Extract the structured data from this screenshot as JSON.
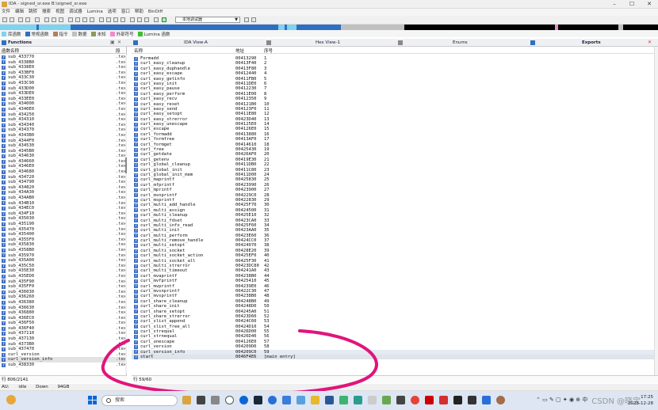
{
  "window": {
    "title": "IDA - signed_sr.exe B:\\signed_sr.exe",
    "controls": [
      "–",
      "☐",
      "✕"
    ]
  },
  "menubar": [
    "文件",
    "编辑",
    "跳转",
    "搜索",
    "视图",
    "调试器",
    "Lumina",
    "选项",
    "窗口",
    "帮助",
    "BinDiff"
  ],
  "toolbar": {
    "debugger_select": "本地调试器"
  },
  "legend": [
    {
      "label": "库函数",
      "color": "#7fd3f0"
    },
    {
      "label": "常规函数",
      "color": "#2f6fc0"
    },
    {
      "label": "指令",
      "color": "#b08060"
    },
    {
      "label": "数据",
      "color": "#c0c0c0"
    },
    {
      "label": "未知",
      "color": "#8a9a5b"
    },
    {
      "label": "外部符号",
      "color": "#f08ad0"
    },
    {
      "label": "Lumina 函数",
      "color": "#3cc030"
    }
  ],
  "tabs": {
    "functions": "Functions",
    "ida_view": "IDA View-A",
    "hex_view": "Hex View-1",
    "enums": "Enums",
    "exports": "Exports"
  },
  "functions_pane": {
    "header_name": "函数名称",
    "header_seg": "段",
    "rows": [
      {
        "name": "sub_433770",
        "seg": ".tex"
      },
      {
        "name": "sub_4338B0",
        "seg": ".tex"
      },
      {
        "name": "sub_4338E0",
        "seg": ".tex"
      },
      {
        "name": "sub_433BF0",
        "seg": ".tex"
      },
      {
        "name": "sub_433C30",
        "seg": ".tex"
      },
      {
        "name": "sub_433C90",
        "seg": ".tex"
      },
      {
        "name": "sub_433D00",
        "seg": ".tex"
      },
      {
        "name": "sub_433DE0",
        "seg": ".tex"
      },
      {
        "name": "sub_433EE0",
        "seg": ".tex"
      },
      {
        "name": "sub_434000",
        "seg": ".tex"
      },
      {
        "name": "sub_4340E0",
        "seg": ".tex"
      },
      {
        "name": "sub_434250",
        "seg": ".tex"
      },
      {
        "name": "sub_434310",
        "seg": ".tex"
      },
      {
        "name": "sub_434340",
        "seg": ".tex"
      },
      {
        "name": "sub_434370",
        "seg": ".tex"
      },
      {
        "name": "sub_4343B0",
        "seg": ".tex"
      },
      {
        "name": "sub_4344F0",
        "seg": ".tex"
      },
      {
        "name": "sub_434530",
        "seg": ".tex"
      },
      {
        "name": "sub_4345B0",
        "seg": ".tex"
      },
      {
        "name": "sub_434630",
        "seg": ".tex"
      },
      {
        "name": "sub_434660",
        "seg": ".tex"
      },
      {
        "name": "sub_4346E0",
        "seg": ".tex"
      },
      {
        "name": "sub_434680",
        "seg": ".tex"
      },
      {
        "name": "sub_434720",
        "seg": ".tex"
      },
      {
        "name": "sub_434790",
        "seg": ".tex"
      },
      {
        "name": "sub_434820",
        "seg": ".tex"
      },
      {
        "name": "sub_434A30",
        "seg": ".tex"
      },
      {
        "name": "sub_434AB0",
        "seg": ".tex"
      },
      {
        "name": "sub_434B10",
        "seg": ".tex"
      },
      {
        "name": "sub_434EC0",
        "seg": ".tex"
      },
      {
        "name": "sub_434F10",
        "seg": ".tex"
      },
      {
        "name": "sub_435030",
        "seg": ".tex"
      },
      {
        "name": "sub_435190",
        "seg": ".tex"
      },
      {
        "name": "sub_435470",
        "seg": ".tex"
      },
      {
        "name": "sub_435400",
        "seg": ".tex"
      },
      {
        "name": "sub_4355F0",
        "seg": ".tex"
      },
      {
        "name": "sub_435830",
        "seg": ".tex"
      },
      {
        "name": "sub_4358B0",
        "seg": ".tex"
      },
      {
        "name": "sub_435970",
        "seg": ".tex"
      },
      {
        "name": "sub_435A00",
        "seg": ".tex"
      },
      {
        "name": "sub_435C50",
        "seg": ".tex"
      },
      {
        "name": "sub_435E30",
        "seg": ".tex"
      },
      {
        "name": "sub_435ED0",
        "seg": ".tex"
      },
      {
        "name": "sub_435F90",
        "seg": ".tex"
      },
      {
        "name": "sub_435FF0",
        "seg": ".tex"
      },
      {
        "name": "sub_436030",
        "seg": ".tex"
      },
      {
        "name": "sub_436260",
        "seg": ".tex"
      },
      {
        "name": "sub_436380",
        "seg": ".tex"
      },
      {
        "name": "sub_436630",
        "seg": ".tex"
      },
      {
        "name": "sub_436880",
        "seg": ".tex"
      },
      {
        "name": "sub_436EC0",
        "seg": ".tex"
      },
      {
        "name": "sub_436F50",
        "seg": ".tex"
      },
      {
        "name": "sub_436F40",
        "seg": ".tex"
      },
      {
        "name": "sub_437110",
        "seg": ".tex"
      },
      {
        "name": "sub_437130",
        "seg": ".tex"
      },
      {
        "name": "sub_4373B0",
        "seg": ".tex"
      },
      {
        "name": "sub_437470",
        "seg": ".tex"
      },
      {
        "name": "curl_version",
        "seg": ".tex"
      },
      {
        "name": "curl_version_info",
        "seg": ".tex",
        "highlight": true
      },
      {
        "name": "sub_438330",
        "seg": ".tex"
      }
    ]
  },
  "exports_pane": {
    "header_name": "名称",
    "header_addr": "地址",
    "header_ord": "序号",
    "rows": [
      {
        "name": "Formadd",
        "addr": "00413290",
        "ord": "1"
      },
      {
        "name": "curl_easy_cleanup",
        "addr": "00413F40",
        "ord": "2"
      },
      {
        "name": "curl_easy_duphandle",
        "addr": "00413F80",
        "ord": "3"
      },
      {
        "name": "curl_easy_escape",
        "addr": "00412440",
        "ord": "4"
      },
      {
        "name": "curl_easy_getinfo",
        "addr": "00411FB0",
        "ord": "5"
      },
      {
        "name": "curl_easy_init",
        "addr": "00411DE0",
        "ord": "6"
      },
      {
        "name": "curl_easy_pause",
        "addr": "00412230",
        "ord": "7"
      },
      {
        "name": "curl_easy_perform",
        "addr": "00411E00",
        "ord": "8"
      },
      {
        "name": "curl_easy_recv",
        "addr": "00412350",
        "ord": "9"
      },
      {
        "name": "curl_easy_reset",
        "addr": "004121B0",
        "ord": "10"
      },
      {
        "name": "curl_easy_send",
        "addr": "004123F0",
        "ord": "11"
      },
      {
        "name": "curl_easy_setopt",
        "addr": "00411E80",
        "ord": "12"
      },
      {
        "name": "curl_easy_strerror",
        "addr": "00423D40",
        "ord": "13"
      },
      {
        "name": "curl_easy_unescape",
        "addr": "004125E0",
        "ord": "14"
      },
      {
        "name": "curl_escape",
        "addr": "004126E0",
        "ord": "15"
      },
      {
        "name": "curl_formadd",
        "addr": "00413880",
        "ord": "16"
      },
      {
        "name": "curl_formfree",
        "addr": "00413AF0",
        "ord": "17"
      },
      {
        "name": "curl_formget",
        "addr": "00414610",
        "ord": "18"
      },
      {
        "name": "curl_free",
        "addr": "00425430",
        "ord": "19"
      },
      {
        "name": "curl_getdate",
        "addr": "00426AF0",
        "ord": "20"
      },
      {
        "name": "curl_getenv",
        "addr": "00419E30",
        "ord": "21"
      },
      {
        "name": "curl_global_cleanup",
        "addr": "00411DB0",
        "ord": "22"
      },
      {
        "name": "curl_global_init",
        "addr": "00411C80",
        "ord": "23"
      },
      {
        "name": "curl_global_init_mem",
        "addr": "00411D00",
        "ord": "24"
      },
      {
        "name": "curl_maprintf",
        "addr": "00425830",
        "ord": "25"
      },
      {
        "name": "curl_mfprintf",
        "addr": "00423990",
        "ord": "26"
      },
      {
        "name": "curl_mprintf",
        "addr": "00423900",
        "ord": "27"
      },
      {
        "name": "curl_msnprintf",
        "addr": "004229C0",
        "ord": "28"
      },
      {
        "name": "curl_msprintf",
        "addr": "00422830",
        "ord": "29"
      },
      {
        "name": "curl_multi_add_handle",
        "addr": "00425F70",
        "ord": "30"
      },
      {
        "name": "curl_multi_assign",
        "addr": "00424500",
        "ord": "31"
      },
      {
        "name": "curl_multi_cleanup",
        "addr": "00425E10",
        "ord": "32"
      },
      {
        "name": "curl_multi_fdset",
        "addr": "00423CA0",
        "ord": "33"
      },
      {
        "name": "curl_multi_info_read",
        "addr": "00425F60",
        "ord": "34"
      },
      {
        "name": "curl_multi_init",
        "addr": "00423AA0",
        "ord": "35"
      },
      {
        "name": "curl_multi_perform",
        "addr": "00423E60",
        "ord": "36"
      },
      {
        "name": "curl_multi_remove_handle",
        "addr": "00424CC0",
        "ord": "37"
      },
      {
        "name": "curl_multi_setopt",
        "addr": "00424070",
        "ord": "38"
      },
      {
        "name": "curl_multi_socket",
        "addr": "00428E20",
        "ord": "39"
      },
      {
        "name": "curl_multi_socket_action",
        "addr": "00425EF0",
        "ord": "40"
      },
      {
        "name": "curl_multi_socket_all",
        "addr": "00425F30",
        "ord": "41"
      },
      {
        "name": "curl_multi_strerror",
        "addr": "00423DC80",
        "ord": "42"
      },
      {
        "name": "curl_multi_timeout",
        "addr": "004241A0",
        "ord": "43"
      },
      {
        "name": "curl_mvaprintf",
        "addr": "004238B0",
        "ord": "44"
      },
      {
        "name": "curl_mvfprintf",
        "addr": "00425410",
        "ord": "45"
      },
      {
        "name": "curl_mvprintf",
        "addr": "004239E0",
        "ord": "46"
      },
      {
        "name": "curl_mvsnprintf",
        "addr": "00422C30",
        "ord": "47"
      },
      {
        "name": "curl_mvsprintf",
        "addr": "004238B0",
        "ord": "48"
      },
      {
        "name": "curl_share_cleanup",
        "addr": "004248B0",
        "ord": "49"
      },
      {
        "name": "curl_share_init",
        "addr": "004248D0",
        "ord": "50"
      },
      {
        "name": "curl_share_setopt",
        "addr": "004245A0",
        "ord": "51"
      },
      {
        "name": "curl_share_strerror",
        "addr": "00423D60",
        "ord": "52"
      },
      {
        "name": "curl_slist_append",
        "addr": "00424C60",
        "ord": "53"
      },
      {
        "name": "curl_slist_free_all",
        "addr": "00424D10",
        "ord": "54"
      },
      {
        "name": "curl_strequal",
        "addr": "00426D00",
        "ord": "55"
      },
      {
        "name": "curl_strnequal",
        "addr": "00426D40",
        "ord": "56"
      },
      {
        "name": "curl_unescape",
        "addr": "004126E0",
        "ord": "57"
      },
      {
        "name": "curl_version",
        "addr": "004209D0",
        "ord": "58"
      },
      {
        "name": "curl_version_info",
        "addr": "004209C0",
        "ord": "59",
        "selected": true
      },
      {
        "name": "start",
        "addr": "0046F4E6",
        "ord": "[main entry]",
        "selected2": true
      }
    ]
  },
  "counts": {
    "functions": "行 806/2141",
    "exports": "行 59/60"
  },
  "status": {
    "au": "AU:",
    "state": "idle",
    "direction": "Down",
    "disk": "94GB"
  },
  "taskbar": {
    "search_placeholder": "搜索",
    "time": "17:25",
    "date": "2025-12-28"
  },
  "watermark": "CSDN @晓宝",
  "icons": {
    "window_close": "close-icon",
    "function": "function-icon",
    "search": "search-icon",
    "start": "windows-start-icon"
  },
  "colors": {
    "annotation_stroke": "#e0157c",
    "function_icon": "#3b6fc4",
    "selected_row": "#e6eaf2"
  }
}
